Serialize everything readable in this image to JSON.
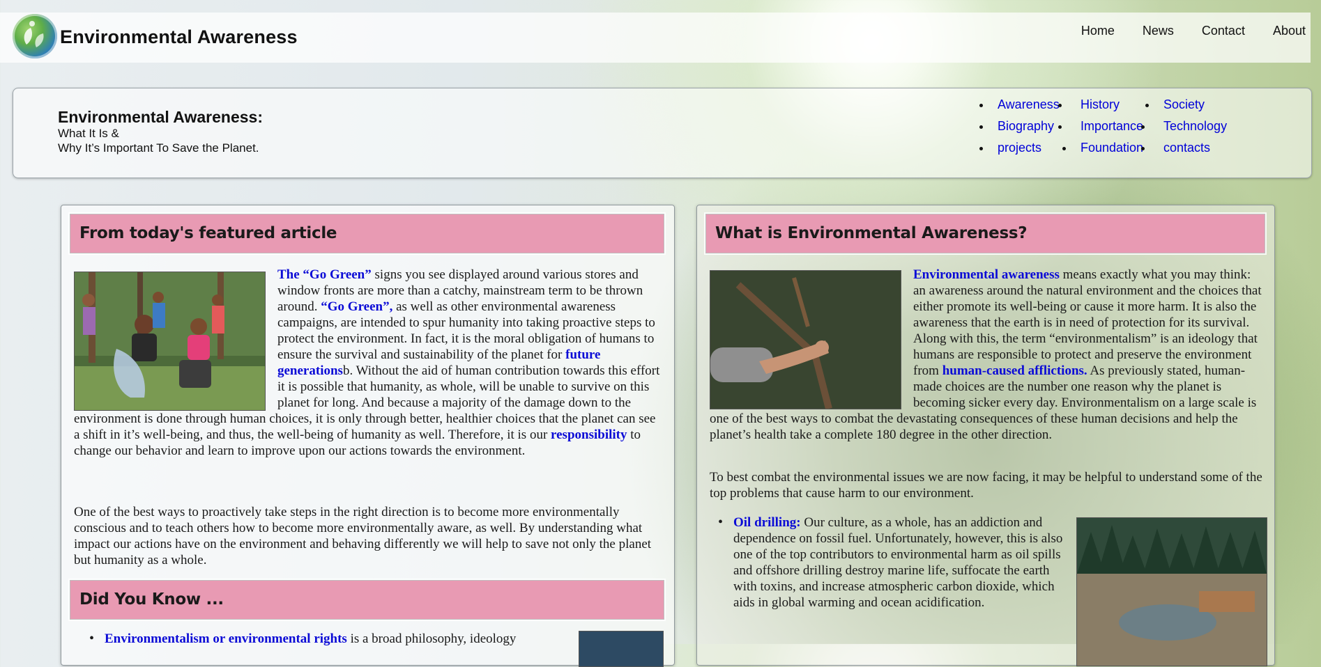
{
  "site": {
    "title": "Environmental Awareness",
    "nav": [
      "Home",
      "News",
      "Contact",
      "About"
    ]
  },
  "banner": {
    "title": "Environmental Awareness:",
    "line1": "What It Is &",
    "line2": "Why It’s Important To Save the Planet.",
    "links": [
      [
        "Awareness",
        "Biography",
        "projects"
      ],
      [
        "History",
        "Importance",
        "Foundation"
      ],
      [
        "Society",
        "Technology",
        "contacts"
      ]
    ]
  },
  "featured": {
    "heading": "From today's featured article",
    "p1": {
      "link1": "The “Go Green”",
      "t1": " signs you see displayed around various stores and window fronts are more than a catchy, mainstream term to be thrown around. ",
      "link2": "“Go Green”,",
      "t2": " as well as other environmental awareness campaigns, are intended to spur humanity into taking proactive steps to protect the environment. In fact, it is the moral obligation of humans to ensure the survival and sustainability of the planet for ",
      "link3": "future generations",
      "t3": "b. Without the aid of human contribution towards this effort it is possible that humanity, as whole, will be unable to survive on this planet for long. And because a majority of the damage down to the environment is done through human choices, it is only through better, healthier choices that the planet can see a shift in it’s well-being, and thus, the well-being of humanity as well. Therefore, it is our ",
      "link4": "responsibility",
      "t4": " to change our behavior and learn to improve upon our actions towards the environment."
    },
    "p2": "One of the best ways to proactively take steps in the right direction is to become more environmentally conscious and to teach others how to become more environmentally aware, as well. By understanding what impact our actions have on the environment and behaving differently we will help to save not only the planet but humanity as a whole."
  },
  "didyouknow": {
    "heading": "Did You Know ...",
    "item1_link": "Environmentalism or environmental rights",
    "item1_text": " is a broad philosophy, ideology"
  },
  "what": {
    "heading": "What is Environmental Awareness?",
    "p1": {
      "link1": "Environmental awareness",
      "t1": " means exactly what you may think: an awareness around the natural environment and the choices that either promote its well-being or cause it more harm. It is also the awareness that the earth is in need of protection for its survival. Along with this, the term “environmentalism” is an ideology that humans are responsible to protect and preserve the environment from ",
      "link2": "human-caused afflictions.",
      "t2": " As previously stated, human-made choices are the number one reason why the planet is becoming sicker every day. Environmentalism on a large scale is one of the best ways to combat the devastating consequences of these human decisions and help the planet’s health take a complete 180 degree in the other direction."
    },
    "p2": "To best combat the environmental issues we are now facing, it may be helpful to understand some of the top problems that cause harm to our environment.",
    "oil_link": "Oil drilling:",
    "oil_text": " Our culture, as a whole, has an addiction and dependence on fossil fuel. Unfortunately, however, this is also one of the top contributors to environmental harm as oil spills and offshore drilling destroy marine life, suffocate the earth with toxins, and increase atmospheric carbon dioxide, which aids in global warming and ocean acidification."
  },
  "colors": {
    "heading_bg": "#e89ab3",
    "link": "#0b0bd6"
  }
}
